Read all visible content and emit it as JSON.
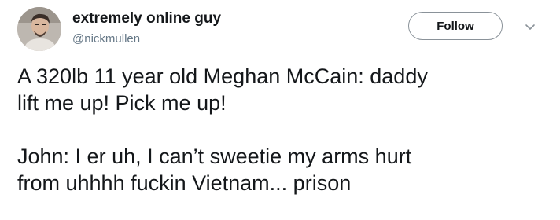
{
  "user": {
    "display_name": "extremely online guy",
    "handle": "@nickmullen"
  },
  "actions": {
    "follow_label": "Follow",
    "menu_icon": "chevron-down-icon"
  },
  "tweet": {
    "lines": [
      "A 320lb 11 year old Meghan McCain: daddy",
      "lift me up! Pick me up!",
      "",
      "John: I er uh, I can’t sweetie my arms hurt",
      "from uhhhh fuckin Vietnam... prison"
    ]
  },
  "colors": {
    "text": "#14171a",
    "secondary_text": "#657786",
    "button_border": "#8a9299"
  }
}
